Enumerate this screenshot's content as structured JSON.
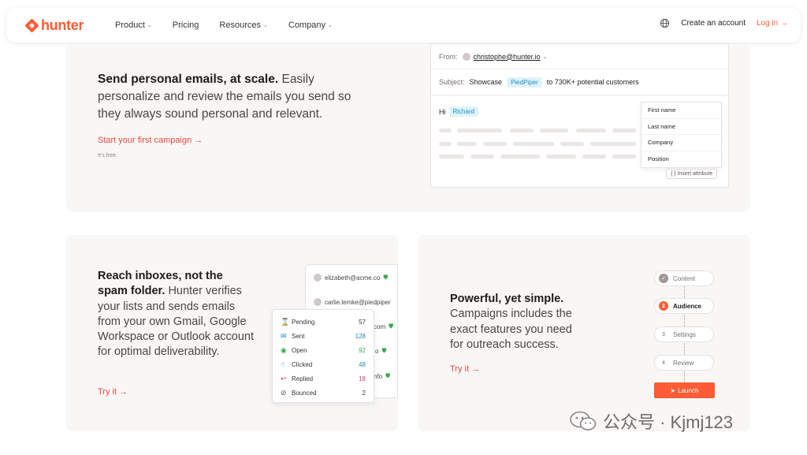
{
  "nav": {
    "logo": "hunter",
    "items": [
      {
        "label": "Product",
        "dropdown": true
      },
      {
        "label": "Pricing",
        "dropdown": false
      },
      {
        "label": "Resources",
        "dropdown": true
      },
      {
        "label": "Company",
        "dropdown": true
      }
    ],
    "create_account": "Create an account",
    "login": "Log in →"
  },
  "hero": {
    "heading_bold": "Send personal emails, at scale.",
    "heading_rest": " Easily personalize and review the emails you send so they always sound personal and relevant.",
    "cta": "Start your first campaign →",
    "note": "It's free."
  },
  "email_mock": {
    "from_label": "From:",
    "from_address": "christophe@hunter.io",
    "subject_label": "Subject:",
    "subject_prefix": "Showcase",
    "subject_tag": "PiedPiper",
    "subject_suffix": "to 730K+ potential customers",
    "greeting": "Hi",
    "greeting_tag": "Richard",
    "attributes": [
      "First name",
      "Last name",
      "Company",
      "Position"
    ],
    "insert_attribute": "{ } Insert attribute"
  },
  "deliverability": {
    "heading_bold": "Reach inboxes, not the spam folder.",
    "heading_rest": " Hunter verifies your lists and sends emails from your own Gmail, Google Workspace or Outlook account for optimal deliverability.",
    "cta": "Try it →",
    "contacts": [
      "elizabeth@acme.co",
      "carlie.lemke@piedpiper",
      "com",
      "o",
      "nfo"
    ],
    "stats": [
      {
        "label": "Pending",
        "value": "57",
        "icon": "hourglass-icon",
        "color": "#3a3533"
      },
      {
        "label": "Sent",
        "value": "128",
        "icon": "mail-icon",
        "color": "#1f8dbf"
      },
      {
        "label": "Open",
        "value": "92",
        "icon": "eye-icon",
        "color": "#3aa84f"
      },
      {
        "label": "Clicked",
        "value": "48",
        "icon": "click-icon",
        "color": "#1f8dbf"
      },
      {
        "label": "Replied",
        "value": "18",
        "icon": "reply-icon",
        "color": "#d6377e"
      },
      {
        "label": "Bounced",
        "value": "2",
        "icon": "ban-icon",
        "color": "#3a3533"
      }
    ]
  },
  "simple": {
    "heading_bold": "Powerful, yet simple.",
    "heading_rest": " Campaigns includes the exact features you need for outreach success.",
    "cta": "Try it →",
    "steps": [
      {
        "num": "✓",
        "label": "Content",
        "state": "done"
      },
      {
        "num": "2",
        "label": "Audience",
        "state": "active"
      },
      {
        "num": "3",
        "label": "Settings",
        "state": "todo"
      },
      {
        "num": "4",
        "label": "Review",
        "state": "todo"
      }
    ],
    "launch": "Launch"
  },
  "watermark": "公众号 · Kjmj123",
  "colors": {
    "brand": "#ff5c35",
    "cta": "#e8493f",
    "card": "#f8f7f6"
  }
}
